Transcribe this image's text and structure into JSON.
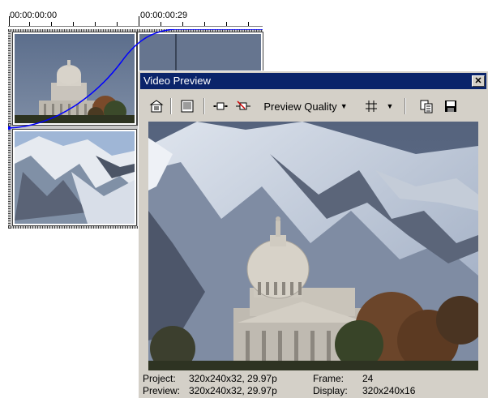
{
  "timeline": {
    "timecode_start": "00:00:00:00",
    "timecode_end": "00:00:00:29"
  },
  "window": {
    "title": "Video Preview",
    "close_glyph": "✕"
  },
  "toolbar": {
    "preview_quality_label": "Preview Quality",
    "icons": [
      "properties-icon",
      "external-monitor-icon",
      "split-screen-icon",
      "split-screen-off-icon",
      "overlay-grid-icon",
      "copy-snapshot-icon",
      "save-snapshot-icon"
    ]
  },
  "status": {
    "project_label": "Project:",
    "project_value": "320x240x32, 29.97p",
    "preview_label": "Preview:",
    "preview_value": "320x240x32, 29.97p",
    "frame_label": "Frame:",
    "frame_value": "24",
    "display_label": "Display:",
    "display_value": "320x240x16"
  },
  "colors": {
    "titlebar": "#0a246a",
    "curve": "#0000ff",
    "window_face": "#d4d0c8"
  }
}
